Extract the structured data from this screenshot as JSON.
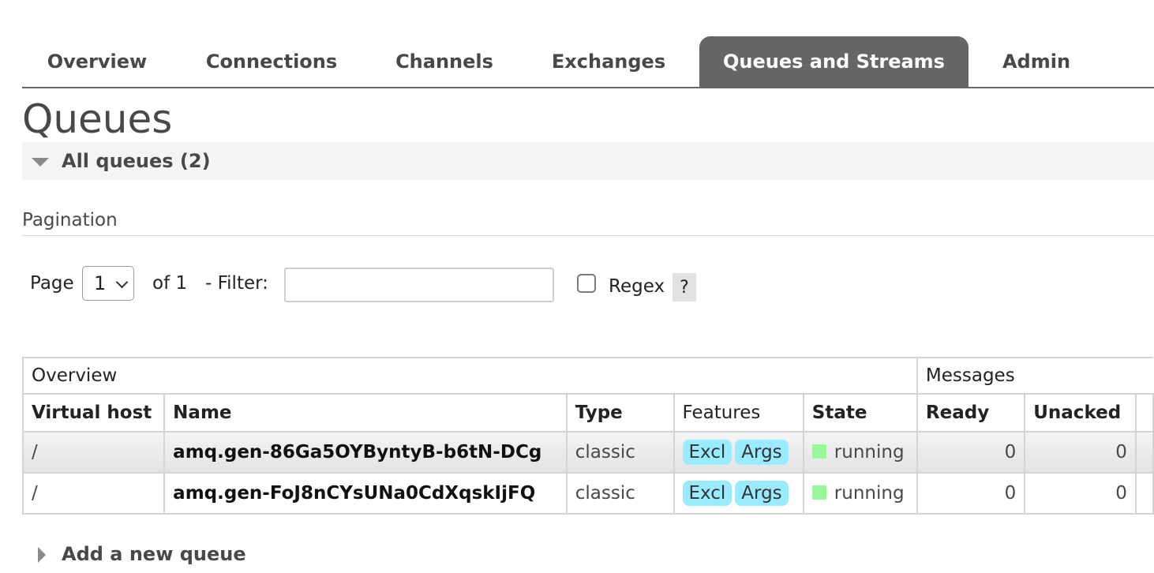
{
  "nav": {
    "tabs": [
      {
        "label": "Overview",
        "active": false
      },
      {
        "label": "Connections",
        "active": false
      },
      {
        "label": "Channels",
        "active": false
      },
      {
        "label": "Exchanges",
        "active": false
      },
      {
        "label": "Queues and Streams",
        "active": true
      },
      {
        "label": "Admin",
        "active": false
      }
    ]
  },
  "page_title": "Queues",
  "section": {
    "label": "All queues (2)"
  },
  "pagination": {
    "label": "Pagination",
    "page_label": "Page",
    "page_value": "1",
    "of_label": "of 1",
    "filter_label": "- Filter:",
    "filter_value": "",
    "regex_label": "Regex",
    "regex_checked": false,
    "help_label": "?"
  },
  "table": {
    "groups": {
      "overview": "Overview",
      "messages": "Messages"
    },
    "columns": {
      "vhost": "Virtual host",
      "name": "Name",
      "type": "Type",
      "features": "Features",
      "state": "State",
      "ready": "Ready",
      "unacked": "Unacked"
    },
    "rows": [
      {
        "vhost": "/",
        "name": "amq.gen-86Ga5OYByntyB-b6tN-DCg",
        "type": "classic",
        "features": [
          "Excl",
          "Args"
        ],
        "state": "running",
        "ready": "0",
        "unacked": "0"
      },
      {
        "vhost": "/",
        "name": "amq.gen-FoJ8nCYsUNa0CdXqskIjFQ",
        "type": "classic",
        "features": [
          "Excl",
          "Args"
        ],
        "state": "running",
        "ready": "0",
        "unacked": "0"
      }
    ]
  },
  "add_queue": {
    "label": "Add a new queue"
  },
  "colors": {
    "tab_active_bg": "#666666",
    "feature_badge": "#99ebff",
    "state_running": "#98f898"
  }
}
